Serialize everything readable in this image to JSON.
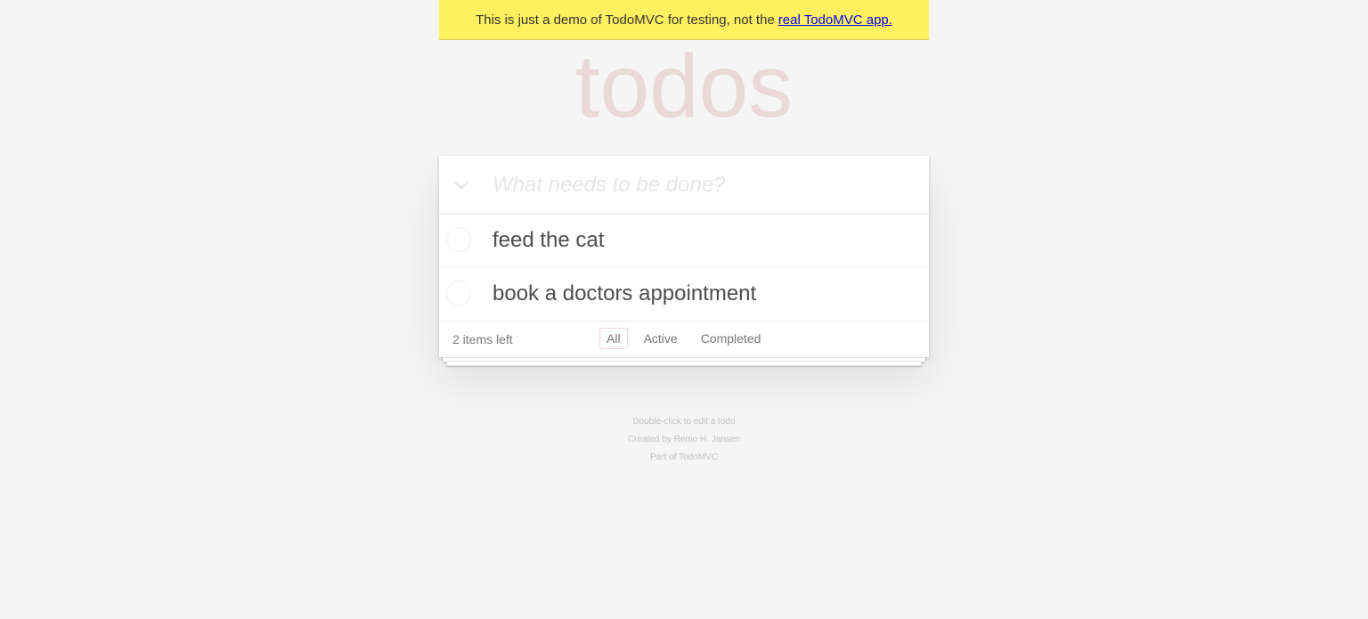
{
  "banner": {
    "text": "This is just a demo of TodoMVC for testing, not the",
    "link_text": "real TodoMVC app."
  },
  "title": "todos",
  "new_todo": {
    "placeholder": "What needs to be done?",
    "value": ""
  },
  "todos": [
    {
      "label": "feed the cat",
      "completed": false
    },
    {
      "label": "book a doctors appointment",
      "completed": false
    }
  ],
  "footer": {
    "count_text": "2 items left",
    "filters": [
      {
        "label": "All",
        "selected": true
      },
      {
        "label": "Active",
        "selected": false
      },
      {
        "label": "Completed",
        "selected": false
      }
    ]
  },
  "info": {
    "line1": "Double-click to edit a todo",
    "line2": "Created by Remo H. Jansen",
    "line3": "Part of TodoMVC"
  },
  "colors": {
    "banner_bg": "#fff05f",
    "title": "#ead7d7",
    "selected_filter_border": "#efd5d5",
    "background": "#f5f5f5"
  },
  "icons": {
    "toggle_all": "chevron-down-icon",
    "todo_toggle": "circle-checkbox-icon"
  }
}
